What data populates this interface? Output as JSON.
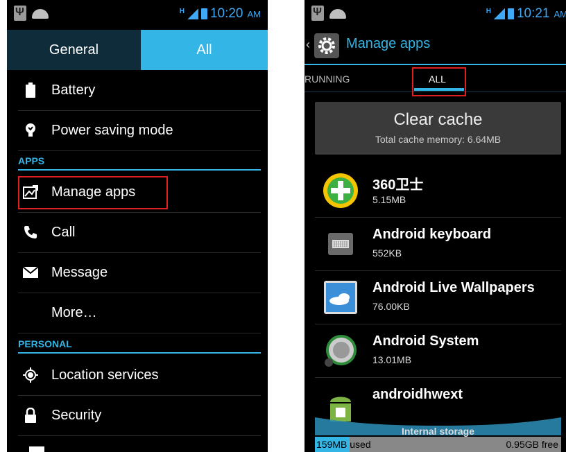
{
  "left": {
    "status": {
      "time": "10:20",
      "ampm": "AM"
    },
    "tabs": {
      "general": "General",
      "all": "All"
    },
    "items_top": [
      {
        "label": "Battery",
        "icon": "battery-icon"
      },
      {
        "label": "Power saving mode",
        "icon": "bulb-icon"
      }
    ],
    "section_apps": "APPS",
    "items_apps": [
      {
        "label": "Manage apps",
        "icon": "manage-apps-icon"
      },
      {
        "label": "Call",
        "icon": "phone-icon"
      },
      {
        "label": "Message",
        "icon": "envelope-icon"
      },
      {
        "label": "More…",
        "icon": ""
      }
    ],
    "section_personal": "PERSONAL",
    "items_personal": [
      {
        "label": "Location services",
        "icon": "location-icon"
      },
      {
        "label": "Security",
        "icon": "lock-icon"
      }
    ]
  },
  "right": {
    "status": {
      "time": "10:21",
      "ampm": "AM"
    },
    "title": "Manage apps",
    "tabs": {
      "running": "RUNNING",
      "all": "ALL"
    },
    "clear_cache": {
      "title": "Clear cache",
      "subtitle": "Total cache memory: 6.64MB"
    },
    "apps": [
      {
        "name": "360卫士",
        "size": "5.15MB",
        "icon": "360-security-icon"
      },
      {
        "name": "Android keyboard",
        "size": "552KB",
        "icon": "keyboard-icon"
      },
      {
        "name": "Android Live Wallpapers",
        "size": "76.00KB",
        "icon": "wallpaper-icon"
      },
      {
        "name": "Android System",
        "size": "13.01MB",
        "icon": "android-system-icon"
      },
      {
        "name": "androidhwext",
        "size": "",
        "icon": "android-robot-icon"
      }
    ],
    "storage": {
      "label": "Internal storage",
      "used": "159MB used",
      "free": "0.95GB free",
      "used_fraction": 0.14
    }
  },
  "colors": {
    "accent": "#33b5e5",
    "highlight": "#e02020",
    "tab_inactive": "#0e2c3a"
  }
}
